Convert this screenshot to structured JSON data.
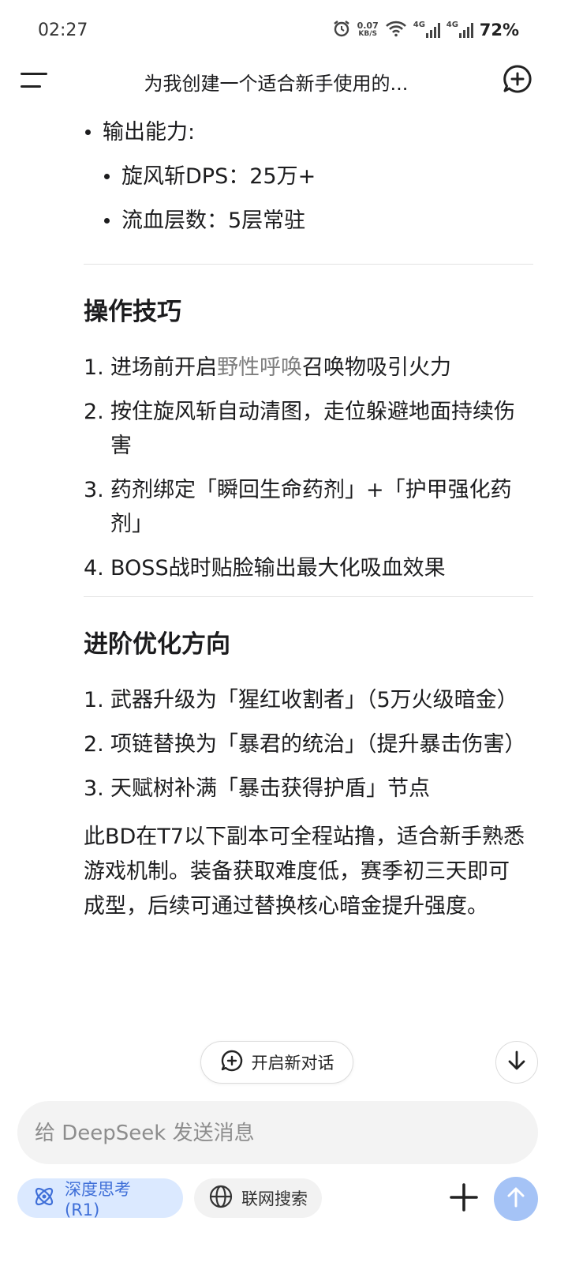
{
  "status_bar": {
    "time": "02:27",
    "net_speed_value": "0.07",
    "net_speed_unit": "KB/S",
    "sim1_tag": "4G",
    "sim2_tag": "4G",
    "battery": "72%"
  },
  "header": {
    "title": "为我创建一个适合新手使用的...",
    "icons": {
      "menu": "menu-icon",
      "new_chat": "new-chat-icon"
    }
  },
  "content": {
    "output_heading": "输出能力:",
    "output_items": [
      "旋风斩DPS：25万+",
      "流血层数：5层常驻"
    ],
    "ops_title": "操作技巧",
    "ops_items": [
      {
        "num": "1.",
        "before": "进场前开启",
        "link": "野性呼唤",
        "after": "召唤物吸引火力"
      },
      {
        "num": "2.",
        "text": "按住旋风斩自动清图，走位躲避地面持续伤害"
      },
      {
        "num": "3.",
        "text": "药剂绑定「瞬回生命药剂」+「护甲强化药剂」"
      },
      {
        "num": "4.",
        "text": "BOSS战时贴脸输出最大化吸血效果"
      }
    ],
    "adv_title": "进阶优化方向",
    "adv_items": [
      {
        "num": "1.",
        "text": "武器升级为「猩红收割者」（5万火级暗金）"
      },
      {
        "num": "2.",
        "text": "项链替换为「暴君的统治」（提升暴击伤害）"
      },
      {
        "num": "3.",
        "text": "天赋树补满「暴击获得护盾」节点"
      }
    ],
    "summary": "此BD在T7以下副本可全程站撸，适合新手熟悉游戏机制。装备获取难度低，赛季初三天即可成型，后续可通过替换核心暗金提升强度。"
  },
  "floating": {
    "new_chat_label": "开启新对话",
    "icons": {
      "new_chat": "chat-plus-icon",
      "scroll_down": "arrow-down-icon"
    }
  },
  "input": {
    "placeholder": "给 DeepSeek 发送消息",
    "value": ""
  },
  "toolbar": {
    "deep_think_label": "深度思考 (R1)",
    "web_search_label": "联网搜索",
    "accent_color": "#3f6fd8",
    "send_color": "#a5c3f6",
    "icons": {
      "deep_think": "atom-icon",
      "web_search": "globe-icon",
      "attach": "plus-icon",
      "send": "arrow-up-icon"
    }
  }
}
